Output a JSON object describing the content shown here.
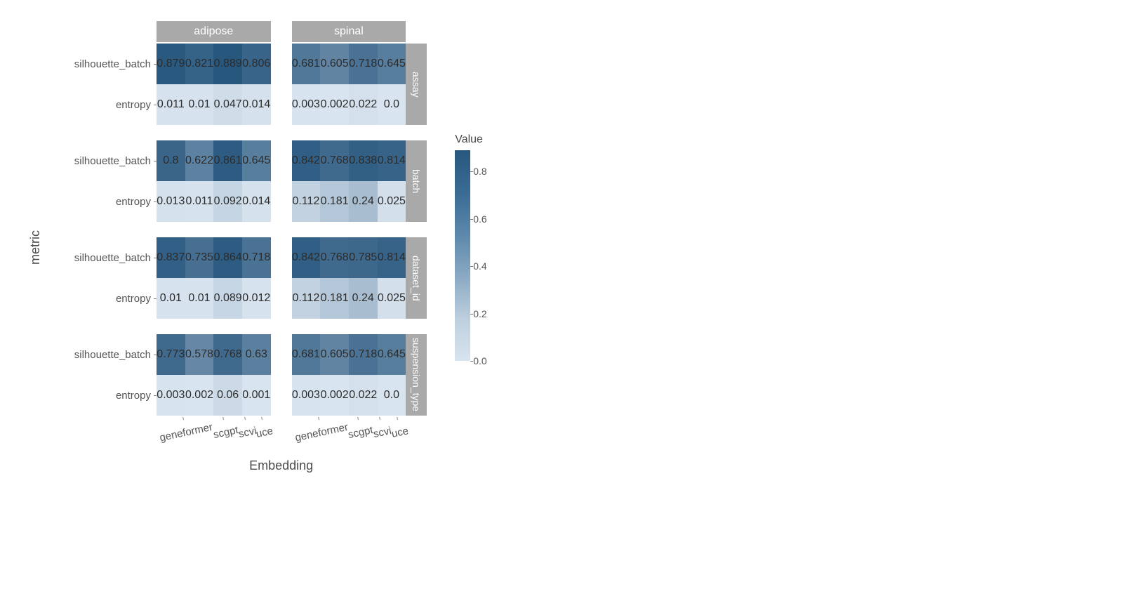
{
  "axis": {
    "x_title": "Embedding",
    "y_title": "metric"
  },
  "legend": {
    "title": "Value",
    "ticks": [
      "0.8",
      "0.6",
      "0.4",
      "0.2",
      "0.0"
    ]
  },
  "cols": [
    "adipose",
    "spinal"
  ],
  "embeddings": [
    "geneformer",
    "scgpt",
    "scvi",
    "uce"
  ],
  "rows": [
    "assay",
    "batch",
    "dataset_id",
    "suspension_type"
  ],
  "metrics": [
    "silhouette_batch",
    "entropy"
  ],
  "chart_data": {
    "type": "heatmap",
    "value_range": [
      0.0,
      0.889
    ],
    "col_facet": "tissue",
    "row_facet": "covariate",
    "x": "Embedding",
    "y": "metric",
    "fill": "Value",
    "facets": {
      "assay": {
        "adipose": {
          "silhouette_batch": {
            "geneformer": 0.879,
            "scgpt": 0.821,
            "scvi": 0.889,
            "uce": 0.806
          },
          "entropy": {
            "geneformer": 0.011,
            "scgpt": 0.01,
            "scvi": 0.047,
            "uce": 0.014
          }
        },
        "spinal": {
          "silhouette_batch": {
            "geneformer": 0.681,
            "scgpt": 0.605,
            "scvi": 0.718,
            "uce": 0.645
          },
          "entropy": {
            "geneformer": 0.003,
            "scgpt": 0.002,
            "scvi": 0.022,
            "uce": 0.0
          }
        }
      },
      "batch": {
        "adipose": {
          "silhouette_batch": {
            "geneformer": 0.8,
            "scgpt": 0.622,
            "scvi": 0.861,
            "uce": 0.645
          },
          "entropy": {
            "geneformer": 0.013,
            "scgpt": 0.011,
            "scvi": 0.092,
            "uce": 0.014
          }
        },
        "spinal": {
          "silhouette_batch": {
            "geneformer": 0.842,
            "scgpt": 0.768,
            "scvi": 0.838,
            "uce": 0.814
          },
          "entropy": {
            "geneformer": 0.112,
            "scgpt": 0.181,
            "scvi": 0.24,
            "uce": 0.025
          }
        }
      },
      "dataset_id": {
        "adipose": {
          "silhouette_batch": {
            "geneformer": 0.837,
            "scgpt": 0.735,
            "scvi": 0.864,
            "uce": 0.718
          },
          "entropy": {
            "geneformer": 0.01,
            "scgpt": 0.01,
            "scvi": 0.089,
            "uce": 0.012
          }
        },
        "spinal": {
          "silhouette_batch": {
            "geneformer": 0.842,
            "scgpt": 0.768,
            "scvi": 0.785,
            "uce": 0.814
          },
          "entropy": {
            "geneformer": 0.112,
            "scgpt": 0.181,
            "scvi": 0.24,
            "uce": 0.025
          }
        }
      },
      "suspension_type": {
        "adipose": {
          "silhouette_batch": {
            "geneformer": 0.773,
            "scgpt": 0.578,
            "scvi": 0.768,
            "uce": 0.63
          },
          "entropy": {
            "geneformer": 0.003,
            "scgpt": 0.002,
            "scvi": 0.06,
            "uce": 0.001
          }
        },
        "spinal": {
          "silhouette_batch": {
            "geneformer": 0.681,
            "scgpt": 0.605,
            "scvi": 0.718,
            "uce": 0.645
          },
          "entropy": {
            "geneformer": 0.003,
            "scgpt": 0.002,
            "scvi": 0.022,
            "uce": 0.0
          }
        }
      }
    }
  }
}
